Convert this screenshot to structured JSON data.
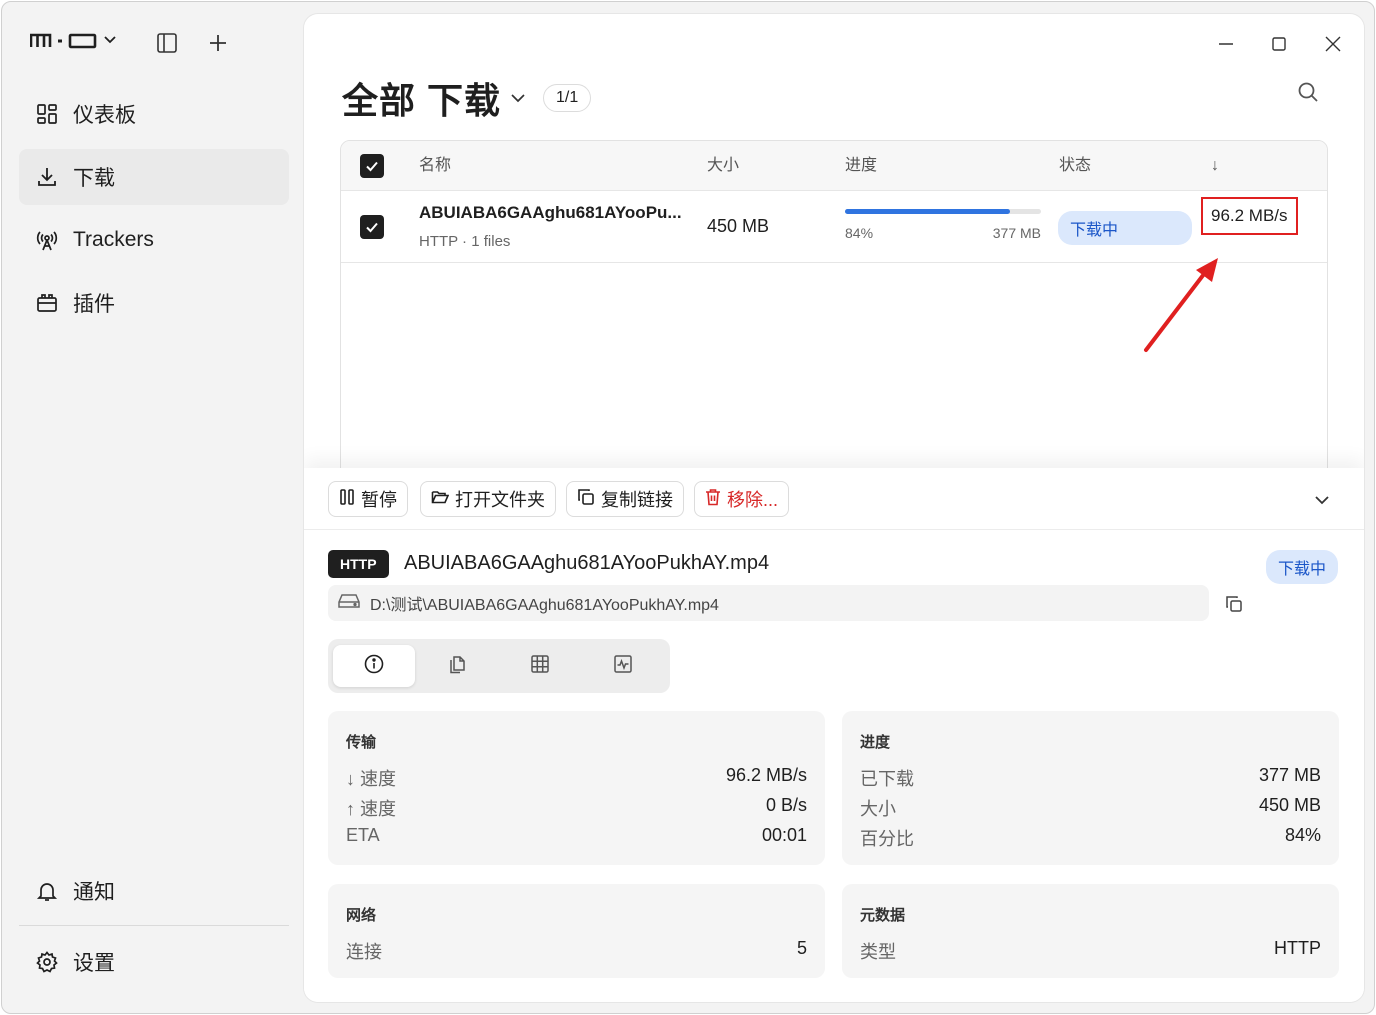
{
  "sidebar": {
    "brand_icon": "m-o-logo",
    "items": [
      {
        "label": "仪表板",
        "icon": "dashboard-icon"
      },
      {
        "label": "下载",
        "icon": "download-icon"
      },
      {
        "label": "Trackers",
        "icon": "antenna-icon"
      },
      {
        "label": "插件",
        "icon": "plugin-icon"
      }
    ],
    "notifications": "通知",
    "settings": "设置"
  },
  "header": {
    "title": "全部 下载",
    "count": "1/1"
  },
  "table": {
    "columns": [
      "名称",
      "大小",
      "进度",
      "状态",
      "↓"
    ],
    "rows": [
      {
        "name": "ABUIABA6GAAghu681AYooPu...",
        "sub": "HTTP · 1 files",
        "size": "450 MB",
        "progress_percent": "84%",
        "progress_value": 0.84,
        "downloaded": "377 MB",
        "status": "下载中",
        "speed": "96.2 MB/s"
      }
    ]
  },
  "toolbar": {
    "pause": "暂停",
    "open_folder": "打开文件夹",
    "copy_link": "复制链接",
    "remove": "移除..."
  },
  "detail": {
    "protocol": "HTTP",
    "filename": "ABUIABA6GAAghu681AYooPukhAY.mp4",
    "status": "下载中",
    "path": "D:\\测试\\ABUIABA6GAAghu681AYooPukhAY.mp4",
    "transfer": {
      "title": "传输",
      "down_label": "↓ 速度",
      "down_value": "96.2 MB/s",
      "up_label": "↑ 速度",
      "up_value": "0 B/s",
      "eta_label": "ETA",
      "eta_value": "00:01"
    },
    "progress": {
      "title": "进度",
      "downloaded_label": "已下载",
      "downloaded_value": "377 MB",
      "size_label": "大小",
      "size_value": "450 MB",
      "percent_label": "百分比",
      "percent_value": "84%"
    },
    "network": {
      "title": "网络",
      "conn_label": "连接",
      "conn_value": "5"
    },
    "metadata": {
      "title": "元数据",
      "type_label": "类型",
      "type_value": "HTTP"
    }
  },
  "colors": {
    "accent": "#2f74e0",
    "status_bg": "#dbe8fc",
    "status_fg": "#1b56c8",
    "danger": "#d72828",
    "highlight_box": "#e02020"
  }
}
